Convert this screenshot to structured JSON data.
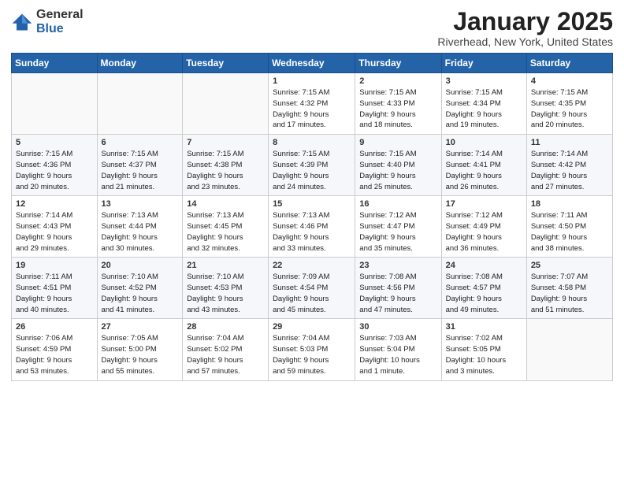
{
  "header": {
    "logo_general": "General",
    "logo_blue": "Blue",
    "month": "January 2025",
    "location": "Riverhead, New York, United States"
  },
  "weekdays": [
    "Sunday",
    "Monday",
    "Tuesday",
    "Wednesday",
    "Thursday",
    "Friday",
    "Saturday"
  ],
  "weeks": [
    [
      {
        "day": "",
        "info": ""
      },
      {
        "day": "",
        "info": ""
      },
      {
        "day": "",
        "info": ""
      },
      {
        "day": "1",
        "info": "Sunrise: 7:15 AM\nSunset: 4:32 PM\nDaylight: 9 hours\nand 17 minutes."
      },
      {
        "day": "2",
        "info": "Sunrise: 7:15 AM\nSunset: 4:33 PM\nDaylight: 9 hours\nand 18 minutes."
      },
      {
        "day": "3",
        "info": "Sunrise: 7:15 AM\nSunset: 4:34 PM\nDaylight: 9 hours\nand 19 minutes."
      },
      {
        "day": "4",
        "info": "Sunrise: 7:15 AM\nSunset: 4:35 PM\nDaylight: 9 hours\nand 20 minutes."
      }
    ],
    [
      {
        "day": "5",
        "info": "Sunrise: 7:15 AM\nSunset: 4:36 PM\nDaylight: 9 hours\nand 20 minutes."
      },
      {
        "day": "6",
        "info": "Sunrise: 7:15 AM\nSunset: 4:37 PM\nDaylight: 9 hours\nand 21 minutes."
      },
      {
        "day": "7",
        "info": "Sunrise: 7:15 AM\nSunset: 4:38 PM\nDaylight: 9 hours\nand 23 minutes."
      },
      {
        "day": "8",
        "info": "Sunrise: 7:15 AM\nSunset: 4:39 PM\nDaylight: 9 hours\nand 24 minutes."
      },
      {
        "day": "9",
        "info": "Sunrise: 7:15 AM\nSunset: 4:40 PM\nDaylight: 9 hours\nand 25 minutes."
      },
      {
        "day": "10",
        "info": "Sunrise: 7:14 AM\nSunset: 4:41 PM\nDaylight: 9 hours\nand 26 minutes."
      },
      {
        "day": "11",
        "info": "Sunrise: 7:14 AM\nSunset: 4:42 PM\nDaylight: 9 hours\nand 27 minutes."
      }
    ],
    [
      {
        "day": "12",
        "info": "Sunrise: 7:14 AM\nSunset: 4:43 PM\nDaylight: 9 hours\nand 29 minutes."
      },
      {
        "day": "13",
        "info": "Sunrise: 7:13 AM\nSunset: 4:44 PM\nDaylight: 9 hours\nand 30 minutes."
      },
      {
        "day": "14",
        "info": "Sunrise: 7:13 AM\nSunset: 4:45 PM\nDaylight: 9 hours\nand 32 minutes."
      },
      {
        "day": "15",
        "info": "Sunrise: 7:13 AM\nSunset: 4:46 PM\nDaylight: 9 hours\nand 33 minutes."
      },
      {
        "day": "16",
        "info": "Sunrise: 7:12 AM\nSunset: 4:47 PM\nDaylight: 9 hours\nand 35 minutes."
      },
      {
        "day": "17",
        "info": "Sunrise: 7:12 AM\nSunset: 4:49 PM\nDaylight: 9 hours\nand 36 minutes."
      },
      {
        "day": "18",
        "info": "Sunrise: 7:11 AM\nSunset: 4:50 PM\nDaylight: 9 hours\nand 38 minutes."
      }
    ],
    [
      {
        "day": "19",
        "info": "Sunrise: 7:11 AM\nSunset: 4:51 PM\nDaylight: 9 hours\nand 40 minutes."
      },
      {
        "day": "20",
        "info": "Sunrise: 7:10 AM\nSunset: 4:52 PM\nDaylight: 9 hours\nand 41 minutes."
      },
      {
        "day": "21",
        "info": "Sunrise: 7:10 AM\nSunset: 4:53 PM\nDaylight: 9 hours\nand 43 minutes."
      },
      {
        "day": "22",
        "info": "Sunrise: 7:09 AM\nSunset: 4:54 PM\nDaylight: 9 hours\nand 45 minutes."
      },
      {
        "day": "23",
        "info": "Sunrise: 7:08 AM\nSunset: 4:56 PM\nDaylight: 9 hours\nand 47 minutes."
      },
      {
        "day": "24",
        "info": "Sunrise: 7:08 AM\nSunset: 4:57 PM\nDaylight: 9 hours\nand 49 minutes."
      },
      {
        "day": "25",
        "info": "Sunrise: 7:07 AM\nSunset: 4:58 PM\nDaylight: 9 hours\nand 51 minutes."
      }
    ],
    [
      {
        "day": "26",
        "info": "Sunrise: 7:06 AM\nSunset: 4:59 PM\nDaylight: 9 hours\nand 53 minutes."
      },
      {
        "day": "27",
        "info": "Sunrise: 7:05 AM\nSunset: 5:00 PM\nDaylight: 9 hours\nand 55 minutes."
      },
      {
        "day": "28",
        "info": "Sunrise: 7:04 AM\nSunset: 5:02 PM\nDaylight: 9 hours\nand 57 minutes."
      },
      {
        "day": "29",
        "info": "Sunrise: 7:04 AM\nSunset: 5:03 PM\nDaylight: 9 hours\nand 59 minutes."
      },
      {
        "day": "30",
        "info": "Sunrise: 7:03 AM\nSunset: 5:04 PM\nDaylight: 10 hours\nand 1 minute."
      },
      {
        "day": "31",
        "info": "Sunrise: 7:02 AM\nSunset: 5:05 PM\nDaylight: 10 hours\nand 3 minutes."
      },
      {
        "day": "",
        "info": ""
      }
    ]
  ]
}
